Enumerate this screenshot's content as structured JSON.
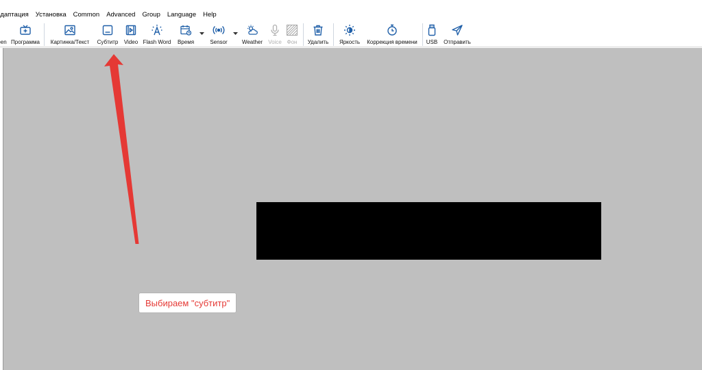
{
  "menu": {
    "items": [
      "Адаптация",
      "Установка",
      "Common",
      "Advanced",
      "Group",
      "Language",
      "Help"
    ]
  },
  "toolbar": {
    "accent_color": "#1f5fa8",
    "screen_label": "Screen",
    "program_label": "Программа",
    "picture_text_label": "Картинка/Текст",
    "subtitle_label": "Субтитр",
    "video_label": "Video",
    "flash_word_label": "Flash Word",
    "time_label": "Время",
    "sensor_label": "Sensor",
    "weather_label": "Weather",
    "voice_label": "Voice",
    "background_label": "Фон",
    "delete_label": "Удалить",
    "brightness_label": "Яркость",
    "time_correction_label": "Коррекция времени",
    "usb_label": "USB",
    "send_label": "Отправить"
  },
  "icons": {
    "screen": "screen-icon",
    "program": "tv-plus-icon",
    "picture_text": "picture-icon",
    "subtitle": "subtitle-icon",
    "video": "video-icon",
    "flash_word": "flash-word-icon",
    "time": "calendar-clock-icon",
    "sensor": "sensor-icon",
    "weather": "weather-icon",
    "voice": "microphone-icon",
    "background": "background-pattern-icon",
    "delete": "trash-icon",
    "brightness": "brightness-icon",
    "time_correction": "stopwatch-icon",
    "usb": "usb-icon",
    "send": "paper-plane-icon"
  },
  "canvas": {
    "background_color": "#bfbfbf",
    "screen_color": "#000000"
  },
  "annotation": {
    "callout_text": "Выбираем \"субтитр\"",
    "arrow_color": "#e53935"
  }
}
